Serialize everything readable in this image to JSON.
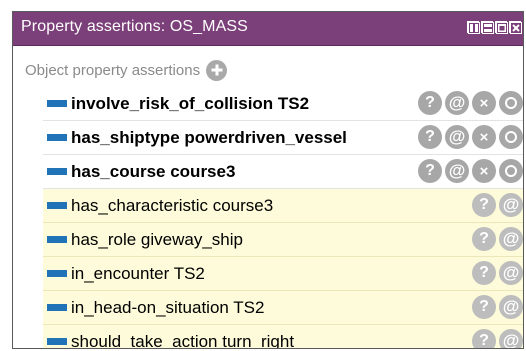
{
  "window": {
    "title": "Property assertions: OS_MASS"
  },
  "section": {
    "label": "Object property assertions"
  },
  "assertions": [
    {
      "property": "involve_risk_of_collision",
      "value": "TS2",
      "text": "involve_risk_of_collision  TS2",
      "inferred": false
    },
    {
      "property": "has_shiptype",
      "value": "powerdriven_vessel",
      "text": "has_shiptype  powerdriven_vessel",
      "inferred": false
    },
    {
      "property": "has_course",
      "value": "course3",
      "text": "has_course  course3",
      "inferred": false
    },
    {
      "property": "has_characteristic",
      "value": "course3",
      "text": "has_characteristic  course3",
      "inferred": true
    },
    {
      "property": "has_role",
      "value": "giveway_ship",
      "text": "has_role  giveway_ship",
      "inferred": true
    },
    {
      "property": "in_encounter",
      "value": "TS2",
      "text": "in_encounter  TS2",
      "inferred": true
    },
    {
      "property": "in_head-on_situation",
      "value": "TS2",
      "text": "in_head-on_situation  TS2",
      "inferred": true
    },
    {
      "property": "should_take_action",
      "value": "turn_right",
      "text": "should_take_action  turn_right",
      "inferred": true
    }
  ],
  "buttons": {
    "explain": "?",
    "annotate": "@",
    "delete": "×"
  },
  "colors": {
    "title_bar": "#7b3f79",
    "property_swatch": "#1f73b6",
    "inferred_background": "#fdfbd9",
    "button_gray": "#a7a7a7"
  }
}
